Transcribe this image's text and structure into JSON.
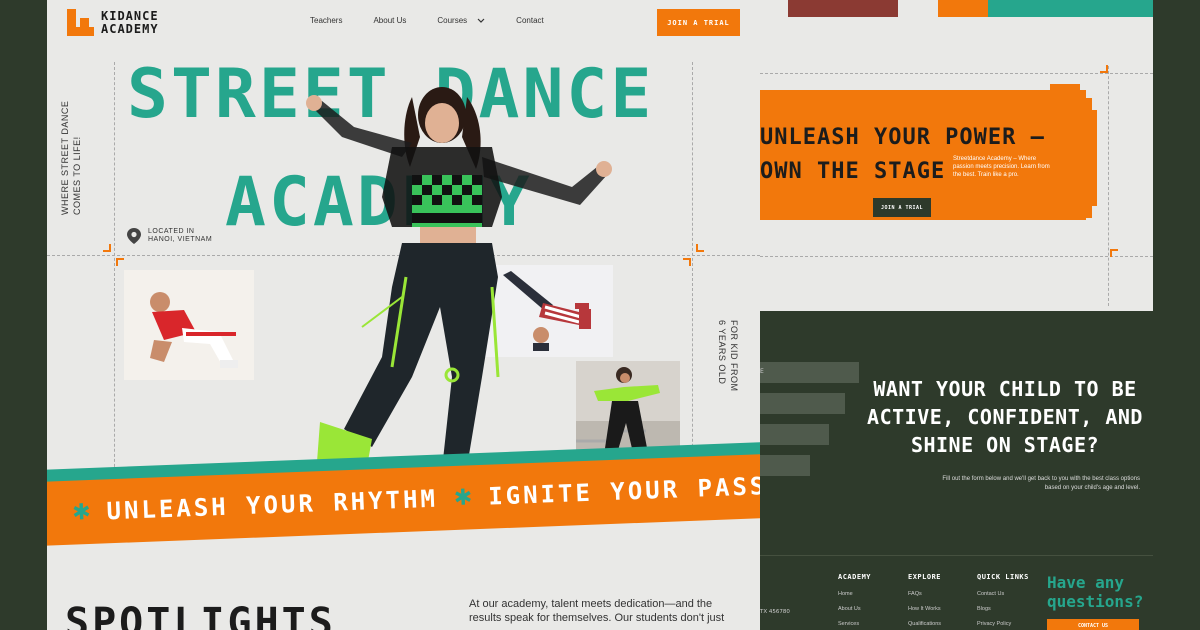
{
  "nav": {
    "logo_line1": "KIDANCE",
    "logo_line2": "ACADEMY",
    "links": [
      "Teachers",
      "About Us",
      "Courses",
      "Contact"
    ],
    "cta": "JOIN A TRIAL"
  },
  "hero": {
    "title_line1": "STREET DANCE",
    "title_line2": "ACADEMY",
    "tagline_line1": "WHERE STREET DANCE",
    "tagline_line2": "COMES TO LIFE!",
    "location_line1": "LOCATED IN",
    "location_line2": "HANOI, VIETNAM",
    "age_line1": "FOR KID FROM",
    "age_line2": "6 YEARS OLD"
  },
  "banner": {
    "phrase1": "UNLEASH YOUR RHYTHM",
    "phrase2": "IGNITE YOUR PASSION"
  },
  "spotlights": {
    "title": "SPOTLIGHTS",
    "text": "At our academy, talent meets dedication—and the results speak for themselves. Our students don't just"
  },
  "cta_section": {
    "line1": "UNLEASH YOUR POWER –",
    "line2": "OWN THE STAGE",
    "desc": "Streetdance Academy – Where passion meets precision. Learn from the best. Train like a pro.",
    "button": "JOIN A TRIAL"
  },
  "form_section": {
    "heading": "WANT YOUR CHILD TO BE ACTIVE, CONFIDENT, AND SHINE ON STAGE?",
    "desc": "Fill out the form below and we'll get back to you with the best class options based on your child's age and level.",
    "field_hint": "E"
  },
  "footer": {
    "address_fragment": "TX 456780",
    "academy_title": "ACADEMY",
    "academy_links": [
      "Home",
      "About Us",
      "Services"
    ],
    "explore_title": "EXPLORE",
    "explore_links": [
      "FAQs",
      "How It Works",
      "Qualifications"
    ],
    "quick_title": "QUICK LINKS",
    "quick_links": [
      "Contact Us",
      "Blogs",
      "Privacy Policy"
    ],
    "question": "Have any questions?",
    "contact_button": "CONTACT US"
  },
  "colors": {
    "orange": "#f2780c",
    "teal": "#26a68d",
    "dark": "#2e3a2b",
    "light_bg": "#e9e9e7"
  }
}
